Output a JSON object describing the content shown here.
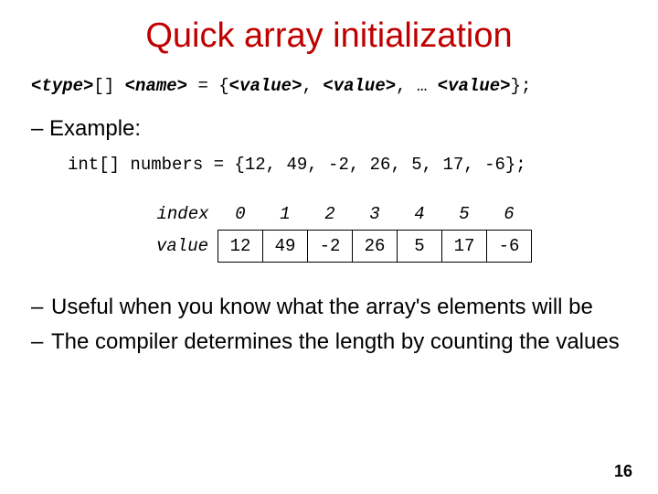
{
  "title": "Quick array initialization",
  "syntax": {
    "type": "<type>",
    "brackets": "[]",
    "name": "<name>",
    "eq": " = {",
    "v1": "<value>",
    "sep1": ", ",
    "v2": "<value>",
    "sep2": ", … ",
    "v3": "<value>",
    "end": "};"
  },
  "example_label": "Example:",
  "code_line": "int[] numbers = {12, 49, -2, 26, 5, 17, -6};",
  "table": {
    "index_label": "index",
    "value_label": "value",
    "indices": [
      "0",
      "1",
      "2",
      "3",
      "4",
      "5",
      "6"
    ],
    "values": [
      "12",
      "49",
      "-2",
      "26",
      "5",
      "17",
      "-6"
    ]
  },
  "bullet1": "Useful when you know what the array's elements will be",
  "bullet2": "The compiler determines the length by counting the values",
  "dash": "–",
  "page_number": "16",
  "chart_data": {
    "type": "table",
    "title": "Array contents",
    "categories": [
      0,
      1,
      2,
      3,
      4,
      5,
      6
    ],
    "values": [
      12,
      49,
      -2,
      26,
      5,
      17,
      -6
    ]
  }
}
